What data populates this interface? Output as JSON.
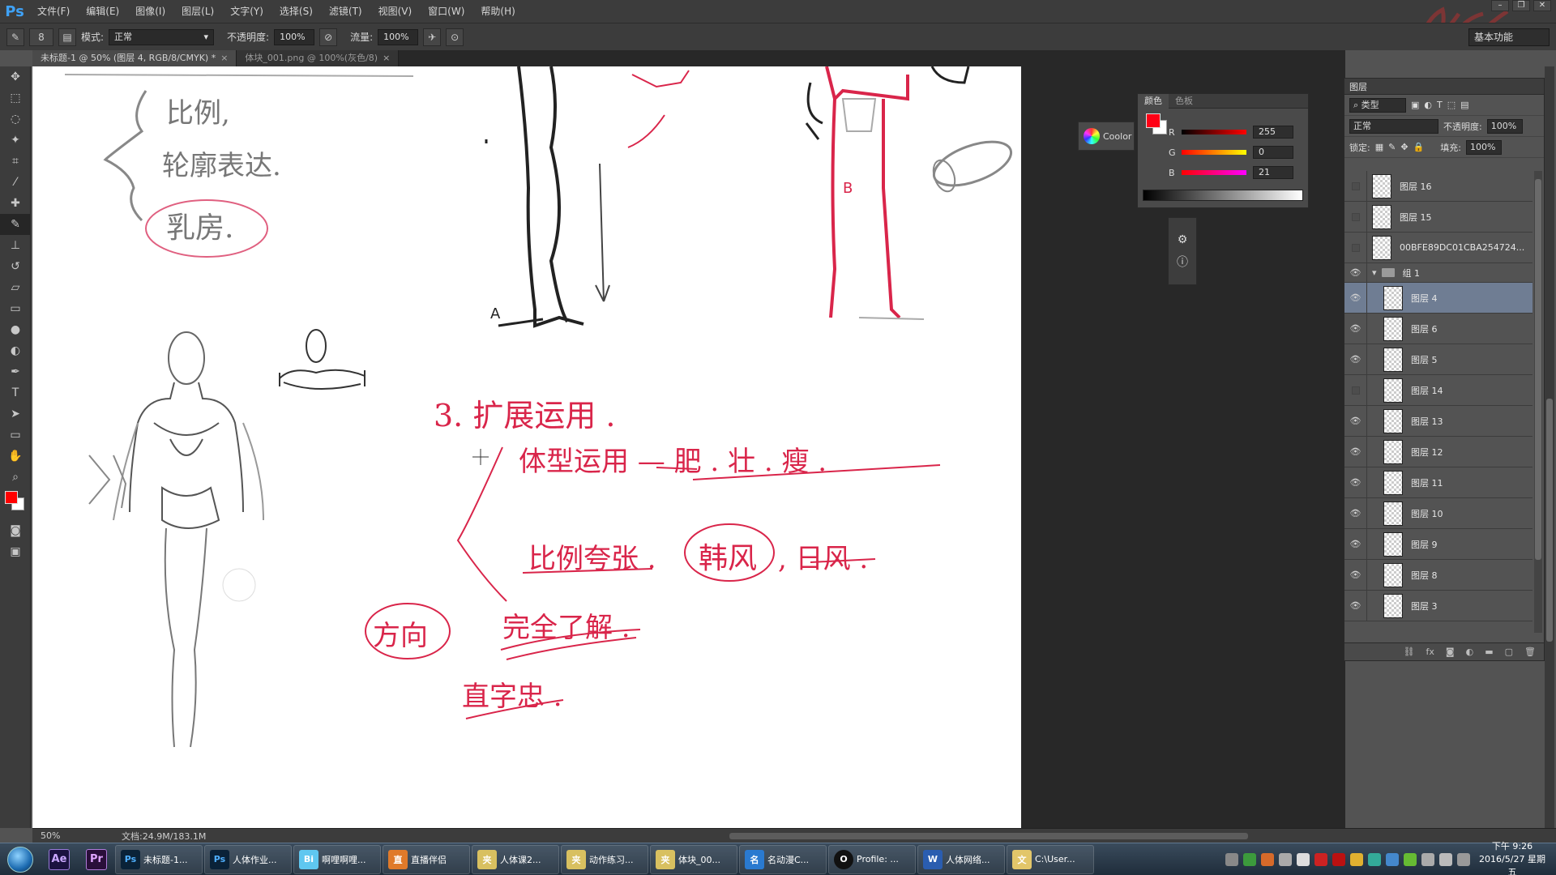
{
  "app": {
    "logo": "Ps"
  },
  "menu": [
    "文件(F)",
    "编辑(E)",
    "图像(I)",
    "图层(L)",
    "文字(Y)",
    "选择(S)",
    "滤镜(T)",
    "视图(V)",
    "窗口(W)",
    "帮助(H)"
  ],
  "options": {
    "brush_size": "8",
    "mode_label": "模式:",
    "mode_value": "正常",
    "opacity_label": "不透明度:",
    "opacity_value": "100%",
    "flow_label": "流量:",
    "flow_value": "100%",
    "workspace": "基本功能"
  },
  "tabs": [
    {
      "label": "未标题-1 @ 50% (图层 4, RGB/8/CMYK) *",
      "close": "×"
    },
    {
      "label": "体块_001.png @ 100%(灰色/8)",
      "close": "×"
    }
  ],
  "status": {
    "zoom": "50%",
    "doc_info": "文档:24.9M/183.1M"
  },
  "color_panel": {
    "tabs": [
      "颜色",
      "色板"
    ],
    "r_label": "R",
    "r_value": "255",
    "g_label": "G",
    "g_value": "0",
    "b_label": "B",
    "b_value": "21",
    "fg_color": "#ff0015"
  },
  "coolorus": {
    "label": "Coolor"
  },
  "layers": {
    "title": "图层",
    "filter_label": "类型",
    "blend_mode": "正常",
    "opacity_label": "不透明度:",
    "opacity_value": "100%",
    "lock_label": "锁定:",
    "fill_label": "填充:",
    "fill_value": "100%",
    "items": [
      {
        "name": "图层 16",
        "visible": false
      },
      {
        "name": "图层 15",
        "visible": false
      },
      {
        "name": "00BFE89DC01CBA254724...",
        "visible": false
      },
      {
        "name": "组 1",
        "visible": true,
        "group": true
      },
      {
        "name": "图层 4",
        "visible": true,
        "selected": true
      },
      {
        "name": "图层 6",
        "visible": true
      },
      {
        "name": "图层 5",
        "visible": true
      },
      {
        "name": "图层 14",
        "visible": false
      },
      {
        "name": "图层 13",
        "visible": true
      },
      {
        "name": "图层 12",
        "visible": true
      },
      {
        "name": "图层 11",
        "visible": true
      },
      {
        "name": "图层 10",
        "visible": true
      },
      {
        "name": "图层 9",
        "visible": true
      },
      {
        "name": "图层 8",
        "visible": true
      },
      {
        "name": "图层 3",
        "visible": true
      }
    ]
  },
  "canvas_notes": {
    "left_top_1": "比例,",
    "left_top_2": "轮廓表达.",
    "left_top_3": "乳房.",
    "heading": "3. 扩展运用 .",
    "line1": "体型运用 — 肥 . 壮 . 瘦 .",
    "line2a": "比例夸张 .",
    "line2b": "韩风",
    "line2c": ", 日风 .",
    "circle_note": "方向",
    "note_a": "完全了解 .",
    "note_b": "直字忠 .",
    "label_a": "A",
    "label_b": "B"
  },
  "taskbar": {
    "pinned": [
      "Ae",
      "Pr"
    ],
    "items": [
      {
        "label": "未标题-1...",
        "icon": "Ps"
      },
      {
        "label": "人体作业...",
        "icon": "Ps"
      },
      {
        "label": "啊哩啊哩...",
        "icon": "Bi"
      },
      {
        "label": "直播伴侣",
        "icon": "直"
      },
      {
        "label": "人体课2...",
        "icon": "夹"
      },
      {
        "label": "动作练习...",
        "icon": "夹"
      },
      {
        "label": "体块_00...",
        "icon": "夹"
      },
      {
        "label": "名动漫C...",
        "icon": "名"
      },
      {
        "label": "Profile: ...",
        "icon": "O"
      },
      {
        "label": "人体网络...",
        "icon": "W"
      },
      {
        "label": "C:\\User...",
        "icon": "文"
      }
    ],
    "clock_time": "下午 9:26",
    "clock_date": "2016/5/27 星期五"
  },
  "colors": {
    "accent_red": "#d9254a",
    "ink": "#1a1a1a",
    "sketch": "#9a9a9a"
  }
}
